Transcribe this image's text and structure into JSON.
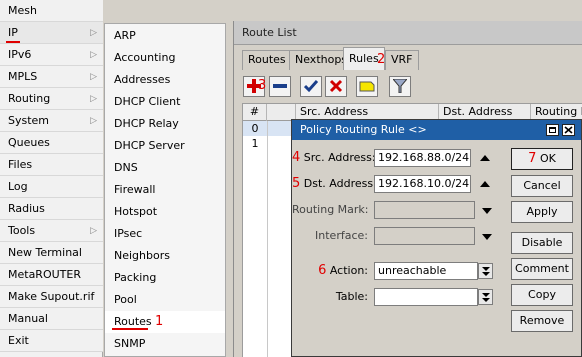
{
  "main_menu": {
    "items": [
      {
        "label": "Mesh",
        "has_arrow": false
      },
      {
        "label": "IP",
        "has_arrow": true
      },
      {
        "label": "IPv6",
        "has_arrow": true
      },
      {
        "label": "MPLS",
        "has_arrow": true
      },
      {
        "label": "Routing",
        "has_arrow": true
      },
      {
        "label": "System",
        "has_arrow": true
      },
      {
        "label": "Queues",
        "has_arrow": false
      },
      {
        "label": "Files",
        "has_arrow": false
      },
      {
        "label": "Log",
        "has_arrow": false
      },
      {
        "label": "Radius",
        "has_arrow": false
      },
      {
        "label": "Tools",
        "has_arrow": true
      },
      {
        "label": "New Terminal",
        "has_arrow": false
      },
      {
        "label": "MetaROUTER",
        "has_arrow": false
      },
      {
        "label": "Make Supout.rif",
        "has_arrow": false
      },
      {
        "label": "Manual",
        "has_arrow": false
      },
      {
        "label": "Exit",
        "has_arrow": false
      }
    ],
    "arrow_glyph": "▷"
  },
  "ip_submenu": {
    "items": [
      "ARP",
      "Accounting",
      "Addresses",
      "DHCP Client",
      "DHCP Relay",
      "DHCP Server",
      "DNS",
      "Firewall",
      "Hotspot",
      "IPsec",
      "Neighbors",
      "Packing",
      "Pool",
      "Routes",
      "SNMP"
    ],
    "selected": "Routes"
  },
  "route_list": {
    "title": "Route List",
    "tabs": [
      "Routes",
      "Nexthops",
      "Rules",
      "VRF"
    ],
    "selected_tab": "Rules",
    "columns": [
      "#",
      "",
      "Src. Address",
      "Dst. Address",
      "Routing Ma"
    ],
    "rows": [
      {
        "num": "0"
      },
      {
        "num": "1"
      }
    ]
  },
  "dialog": {
    "title": "Policy Routing Rule <>",
    "fields": {
      "src_address": {
        "label": "Src. Address:",
        "value": "192.168.88.0/24"
      },
      "dst_address": {
        "label": "Dst. Address:",
        "value": "192.168.10.0/24"
      },
      "routing_mark": {
        "label": "Routing Mark:",
        "value": ""
      },
      "interface": {
        "label": "Interface:",
        "value": ""
      },
      "action": {
        "label": "Action:",
        "value": "unreachable"
      },
      "table": {
        "label": "Table:",
        "value": ""
      }
    },
    "buttons": [
      "OK",
      "Cancel",
      "Apply",
      "Disable",
      "Comment",
      "Copy",
      "Remove"
    ]
  },
  "step_markers": {
    "one": "1",
    "two": "2",
    "three": "3",
    "four": "4",
    "five": "5",
    "six": "6",
    "seven": "7"
  },
  "colors": {
    "annotation_red": "#e00000",
    "dialog_title_blue": "#1f5fa6",
    "selected_row_blue": "#d8e4f4"
  }
}
